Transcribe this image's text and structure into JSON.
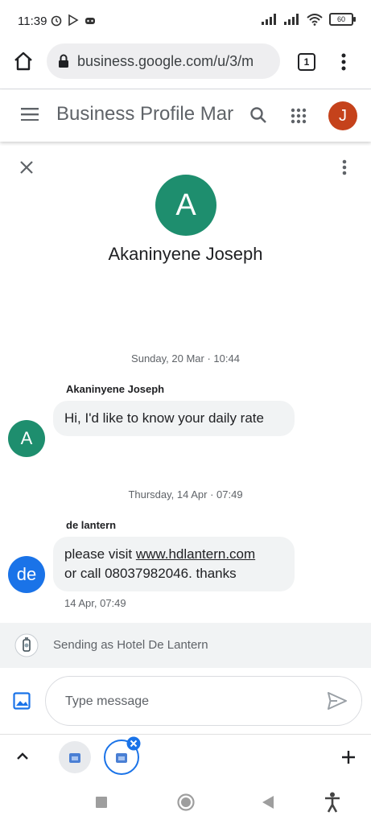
{
  "status_bar": {
    "time": "11:39",
    "battery": "60"
  },
  "browser": {
    "url": "business.google.com/u/3/m",
    "tab_count": "1"
  },
  "app": {
    "title": "Business Profile Mar",
    "account_initial": "J"
  },
  "contact": {
    "initial": "A",
    "name": "Akaninyene Joseph"
  },
  "messages": [
    {
      "date": "Sunday, 20 Mar · 10:44",
      "sender": "Akaninyene Joseph",
      "avatar": "A",
      "text": "Hi, I'd like to know your daily rate"
    },
    {
      "date": "Thursday, 14 Apr · 07:49",
      "sender": "de lantern",
      "avatar": "de",
      "text_prefix": "please visit ",
      "link": "www.hdlantern.com",
      "text_suffix": "or call 08037982046. thanks",
      "timestamp": "14 Apr, 07:49"
    }
  ],
  "sending_as": "Sending as Hotel De Lantern",
  "compose": {
    "placeholder": "Type message"
  },
  "colors": {
    "accent": "#1a73e8",
    "avatar_green": "#1e8e6e",
    "avatar_blue": "#1a73e8",
    "account_red": "#c5421b"
  }
}
